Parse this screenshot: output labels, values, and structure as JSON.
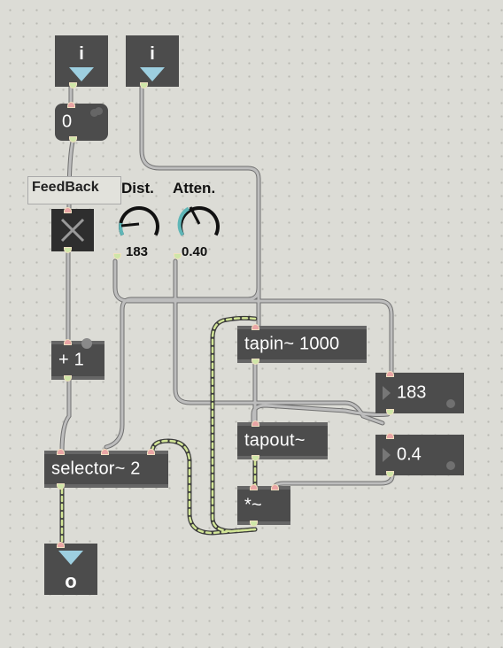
{
  "patcher": {
    "inlet_left": {
      "label": "i"
    },
    "inlet_right": {
      "label": "i"
    },
    "toggle_number": {
      "value": "0"
    },
    "feedback_label": "FeedBack",
    "dial_dist": {
      "label": "Dist.",
      "value": "183"
    },
    "dial_atten": {
      "label": "Atten.",
      "value": "0.40"
    },
    "plus_one": {
      "text": "+ 1"
    },
    "tapin": {
      "text": "tapin~ 1000"
    },
    "tapout": {
      "text": "tapout~"
    },
    "multiply": {
      "text": "*~"
    },
    "selector": {
      "text": "selector~ 2"
    },
    "number_183": {
      "value": "183"
    },
    "number_04": {
      "value": "0.4"
    },
    "outlet": {
      "label": "o"
    }
  },
  "colors": {
    "object_bg": "#4c4c4c",
    "cable": "#a8a8a8",
    "signal_cable_dash": "#d2e596",
    "dial_accent": "#5fb6b7"
  }
}
